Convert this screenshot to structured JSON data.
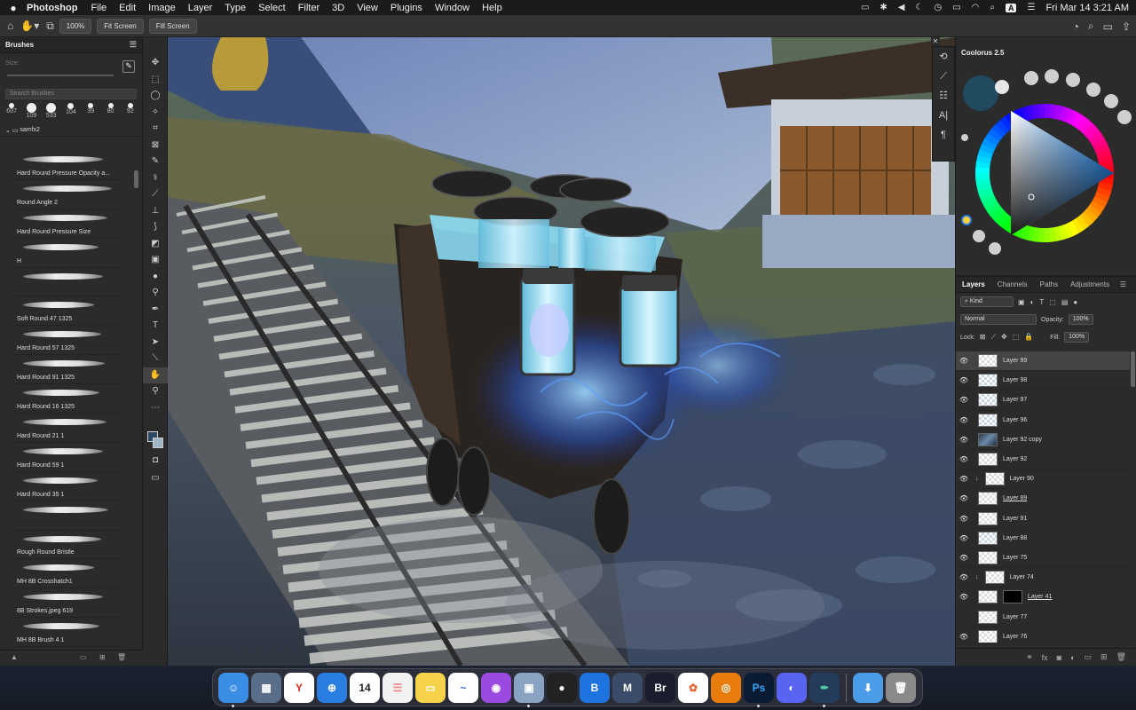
{
  "menubar": {
    "app_name": "Photoshop",
    "menus": [
      "File",
      "Edit",
      "Image",
      "Layer",
      "Type",
      "Select",
      "Filter",
      "3D",
      "View",
      "Plugins",
      "Window",
      "Help"
    ],
    "clock": "Fri Mar 14  3:21 AM",
    "keyboard_indicator": "A"
  },
  "options_bar": {
    "zoom_button": "100%",
    "fit_screen": "Fit Screen",
    "fill_screen": "Fill Screen"
  },
  "brushes_panel": {
    "title": "Brushes",
    "size_label": "Size:",
    "search_placeholder": "Search Brushes",
    "presets": [
      "607",
      "109",
      "533",
      "104",
      "39",
      "80",
      "92"
    ],
    "folder": "samfx2",
    "items": [
      "Hard Round Pressure Opacity a...",
      "Round Angle 2",
      "Hard Round Pressure Size",
      "H",
      "",
      "Soft Round 47 1325",
      "Hard Round 57 1325",
      "Hard Round 91 1325",
      "Hard Round 16 1325",
      "Hard Round 21 1",
      "Hard Round 59 1",
      "Hard Round 35 1",
      "",
      "Rough Round Bristle",
      "MH 8B Crosshatch1",
      "8B Strokes.jpeg 619",
      "MH 8B Brush 4 1"
    ]
  },
  "coolorus": {
    "title": "Coolorus 2.5",
    "current_color": "#1f4a60"
  },
  "layers_panel": {
    "tabs": [
      "Layers",
      "Channels",
      "Paths",
      "Adjustments"
    ],
    "kind_filter": "Kind",
    "blend_mode": "Normal",
    "opacity_label": "Opacity:",
    "opacity_value": "100%",
    "lock_label": "Lock:",
    "fill_label": "Fill:",
    "fill_value": "100%",
    "layers": [
      {
        "name": "Layer 99",
        "thumb": "blank",
        "visible": true,
        "active": true
      },
      {
        "name": "Layer 98",
        "thumb": "blue",
        "visible": true
      },
      {
        "name": "Layer 97",
        "thumb": "blue",
        "visible": true
      },
      {
        "name": "Layer 96",
        "thumb": "blue",
        "visible": true
      },
      {
        "name": "Layer 92 copy",
        "thumb": "img",
        "visible": true
      },
      {
        "name": "Layer 92",
        "thumb": "blank",
        "visible": true
      },
      {
        "name": "Layer 90",
        "thumb": "blank",
        "visible": true,
        "clipped": true
      },
      {
        "name": "Layer 89",
        "thumb": "blank",
        "visible": true,
        "underline": true
      },
      {
        "name": "Layer 91",
        "thumb": "blank",
        "visible": true
      },
      {
        "name": "Layer 88",
        "thumb": "blue",
        "visible": true
      },
      {
        "name": "Layer 75",
        "thumb": "blank",
        "visible": true
      },
      {
        "name": "Layer 74",
        "thumb": "blank",
        "visible": true,
        "clipped": true
      },
      {
        "name": "Layer 41",
        "thumb": "blank",
        "visible": true,
        "mask": true,
        "underline": true
      },
      {
        "name": "Layer 77",
        "thumb": "blank",
        "visible": false
      },
      {
        "name": "Layer 76",
        "thumb": "blank",
        "visible": true
      }
    ]
  },
  "dock": {
    "apps": [
      {
        "name": "Finder",
        "color": "#3a8ee6",
        "glyph": "☺",
        "running": true
      },
      {
        "name": "Launchpad",
        "color": "#5a6e8a",
        "glyph": "▦"
      },
      {
        "name": "Yandex",
        "color": "#ffffff",
        "glyph": "Y",
        "fg": "#e0281c"
      },
      {
        "name": "Safari",
        "color": "#2a7de1",
        "glyph": "⊕"
      },
      {
        "name": "Calendar",
        "color": "#ffffff",
        "glyph": "14",
        "fg": "#222"
      },
      {
        "name": "Reminders",
        "color": "#f2f2f2",
        "glyph": "☰",
        "fg": "#e88"
      },
      {
        "name": "Notes",
        "color": "#f6d34a",
        "glyph": "▭",
        "fg": "#fff"
      },
      {
        "name": "Freeform",
        "color": "#ffffff",
        "glyph": "~",
        "fg": "#2a6ad9"
      },
      {
        "name": "Podcasts",
        "color": "#9b4ae0",
        "glyph": "◉"
      },
      {
        "name": "Preview",
        "color": "#8aa3c2",
        "glyph": "▣",
        "running": true
      },
      {
        "name": "Motion",
        "color": "#222",
        "glyph": "●"
      },
      {
        "name": "Teamviewer",
        "color": "#1f73e0",
        "glyph": "B"
      },
      {
        "name": "Mail",
        "color": "#3b4c6b",
        "glyph": "M"
      },
      {
        "name": "Bridge",
        "color": "#1a1d2e",
        "glyph": "Br"
      },
      {
        "name": "Photos",
        "color": "#ffffff",
        "glyph": "✿",
        "fg": "#e8602c"
      },
      {
        "name": "Blender",
        "color": "#e87d0d",
        "glyph": "◎"
      },
      {
        "name": "Photoshop",
        "color": "#0a1b33",
        "glyph": "Ps",
        "fg": "#31a8ff",
        "running": true
      },
      {
        "name": "Discord",
        "color": "#5865f2",
        "glyph": "◐"
      },
      {
        "name": "Krita",
        "color": "#243b5c",
        "glyph": "✒",
        "fg": "#4fd1a5",
        "running": true
      }
    ],
    "trash_apps": [
      {
        "name": "Downloads",
        "color": "#4a9be8",
        "glyph": "⬇"
      },
      {
        "name": "Trash",
        "color": "#8a8a8a",
        "glyph": "🗑"
      }
    ]
  }
}
